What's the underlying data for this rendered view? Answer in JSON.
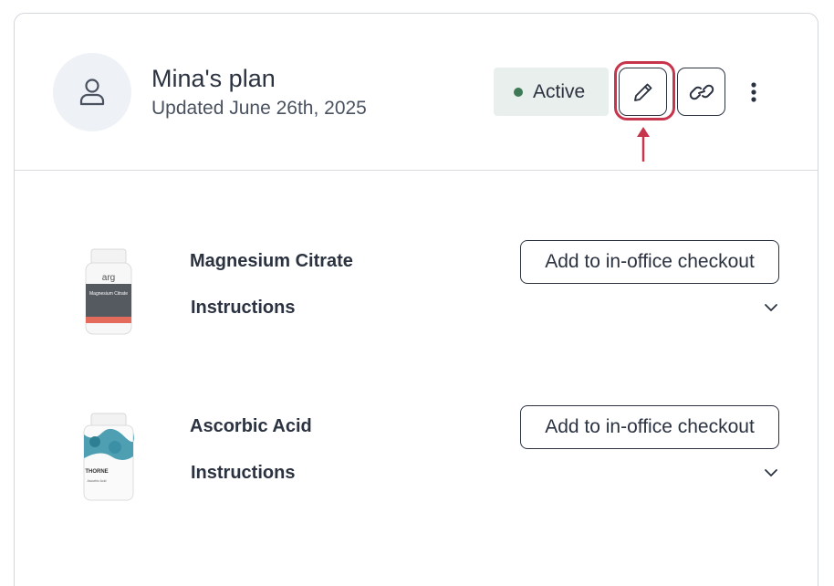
{
  "plan": {
    "title": "Mina's plan",
    "updated": "Updated June 26th, 2025",
    "status": "Active",
    "status_color": "#3f7a56",
    "highlight_color": "#c7354d"
  },
  "icons": {
    "avatar": "person-icon",
    "edit": "pencil-icon",
    "link": "link-icon",
    "more": "more-vertical-icon",
    "expand": "chevron-down-icon"
  },
  "products": [
    {
      "name": "Magnesium Citrate",
      "instructions_label": "Instructions",
      "checkout_label": "Add to in-office checkout",
      "image_brand": "arg",
      "image_label": "Magnesium Citrate"
    },
    {
      "name": "Ascorbic Acid",
      "instructions_label": "Instructions",
      "checkout_label": "Add to in-office checkout",
      "image_brand": "THORNE",
      "image_label": "Ascorbic Acid"
    }
  ]
}
